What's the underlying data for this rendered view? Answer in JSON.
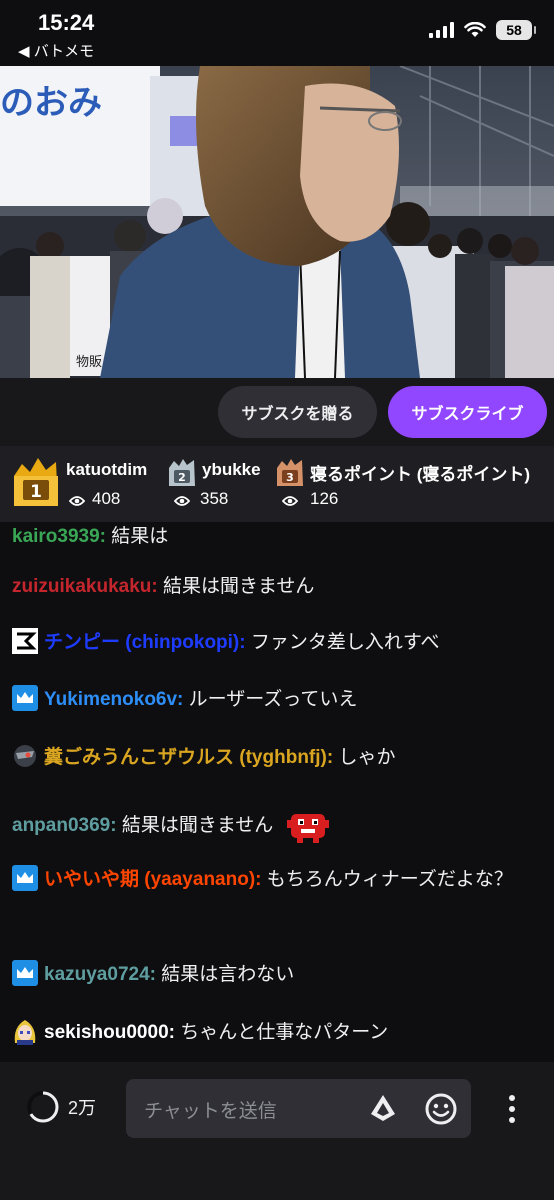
{
  "status_bar": {
    "time": "15:24",
    "back_app": "◀ バトメモ",
    "battery": "58"
  },
  "video": {
    "sign_text": "のおみ"
  },
  "subscribe": {
    "gift_label": "サブスクを贈る",
    "subscribe_label": "サブスクライブ",
    "accent_color": "#9147ff"
  },
  "leaderboard": [
    {
      "rank": "1",
      "name": "katuotdim",
      "count": "408"
    },
    {
      "rank": "2",
      "name": "ybukke",
      "count": "358"
    },
    {
      "rank": "3",
      "name": "寝るポイント (寝るポイント)",
      "count": "126"
    }
  ],
  "chat": {
    "messages": [
      {
        "user": "kairo3939:",
        "text": " 結果は",
        "color": "#3aa757",
        "badge": ""
      },
      {
        "user": "zuizuikakukaku:",
        "text": " 結果は聞きません",
        "color": "#c4262d",
        "badge": ""
      },
      {
        "user": "チンピー (chinpokopi):",
        "text": " ファンタ差し入れすべ",
        "color": "#1e3cff",
        "badge": "logo"
      },
      {
        "user": "Yukimenoko6v:",
        "text": " ルーザーズっていえ",
        "color": "#2e8ef7",
        "badge": "crown"
      },
      {
        "user": "糞ごみうんこザウルス (tyghbnfj):",
        "text": " しゃか",
        "color": "#daa520",
        "badge": "avatar"
      },
      {
        "user": "anpan0369:",
        "text": " 結果は聞きません",
        "color": "#5f9ea0",
        "badge": "",
        "emote": "meat-boy"
      },
      {
        "user": "いやいや期 (yaayanano):",
        "text": " もちろんウィナーズだよな？",
        "color": "#ff4500",
        "badge": "crown"
      },
      {
        "user": "kazuya0724:",
        "text": " 結果は言わない",
        "color": "#5f9ea0",
        "badge": "crown"
      },
      {
        "user": "sekishou0000:",
        "text": " ちゃんと仕事なパターン",
        "color": "#ffffff",
        "badge": "anime"
      }
    ]
  },
  "bottom_bar": {
    "viewers": "2万",
    "chat_placeholder": "チャットを送信"
  }
}
